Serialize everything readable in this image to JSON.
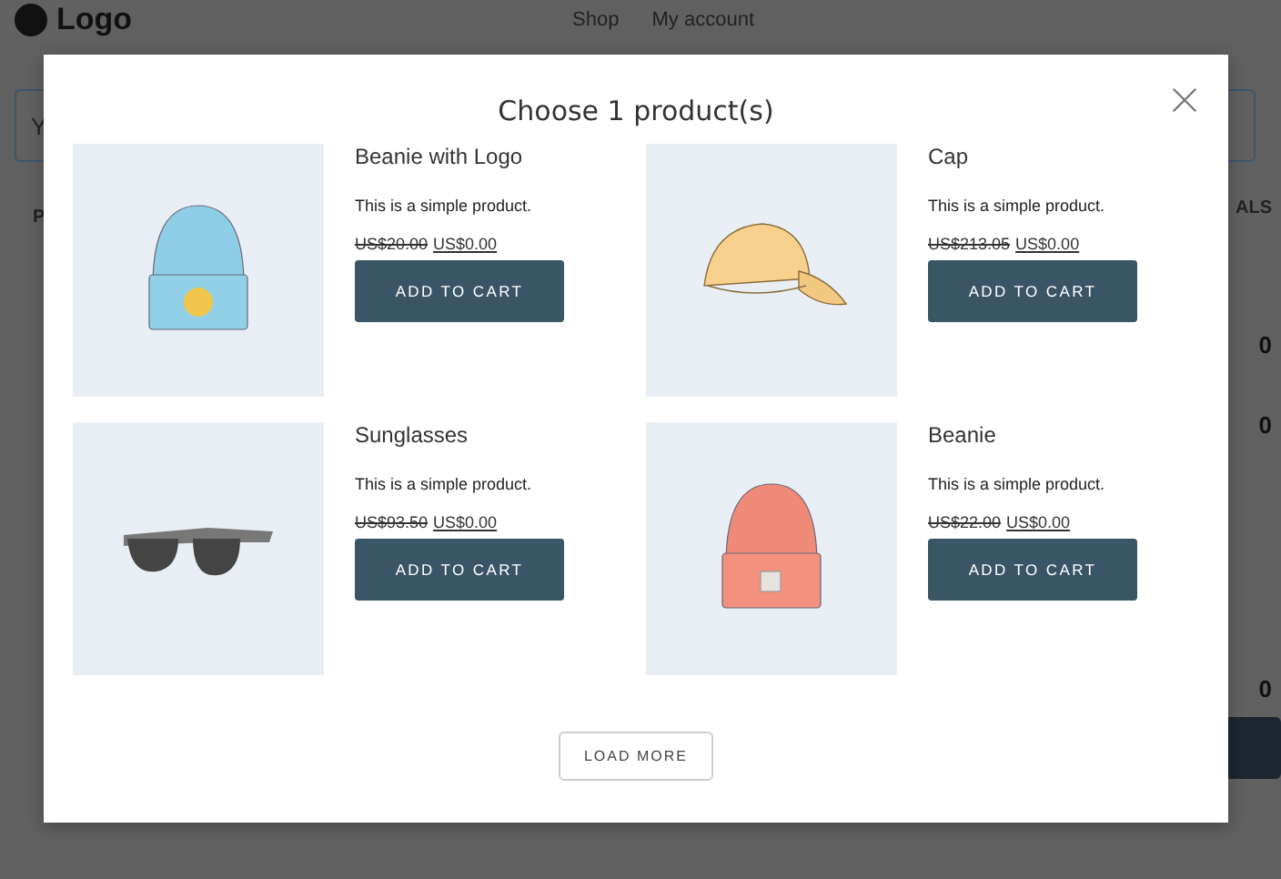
{
  "page": {
    "logo": "Logo",
    "nav": [
      "Shop",
      "My account"
    ],
    "field_fragment": "Y",
    "left_fragment": "P",
    "right_heading_fragment": "ALS",
    "right_values": [
      "0",
      "0",
      "0"
    ]
  },
  "modal": {
    "title": "Choose 1 product(s)",
    "products": [
      {
        "name": "Beanie with Logo",
        "description": "This is a simple product.",
        "regular_price": "US$20.00",
        "sale_price": "US$0.00",
        "button": "ADD TO CART",
        "kind": "beanie-logo"
      },
      {
        "name": "Cap",
        "description": "This is a simple product.",
        "regular_price": "US$213.05",
        "sale_price": "US$0.00",
        "button": "ADD TO CART",
        "kind": "cap"
      },
      {
        "name": "Sunglasses",
        "description": "This is a simple product.",
        "regular_price": "US$93.50",
        "sale_price": "US$0.00",
        "button": "ADD TO CART",
        "kind": "sunglasses"
      },
      {
        "name": "Beanie",
        "description": "This is a simple product.",
        "regular_price": "US$22.00",
        "sale_price": "US$0.00",
        "button": "ADD TO CART",
        "kind": "beanie"
      }
    ],
    "load_more": "LOAD MORE"
  }
}
